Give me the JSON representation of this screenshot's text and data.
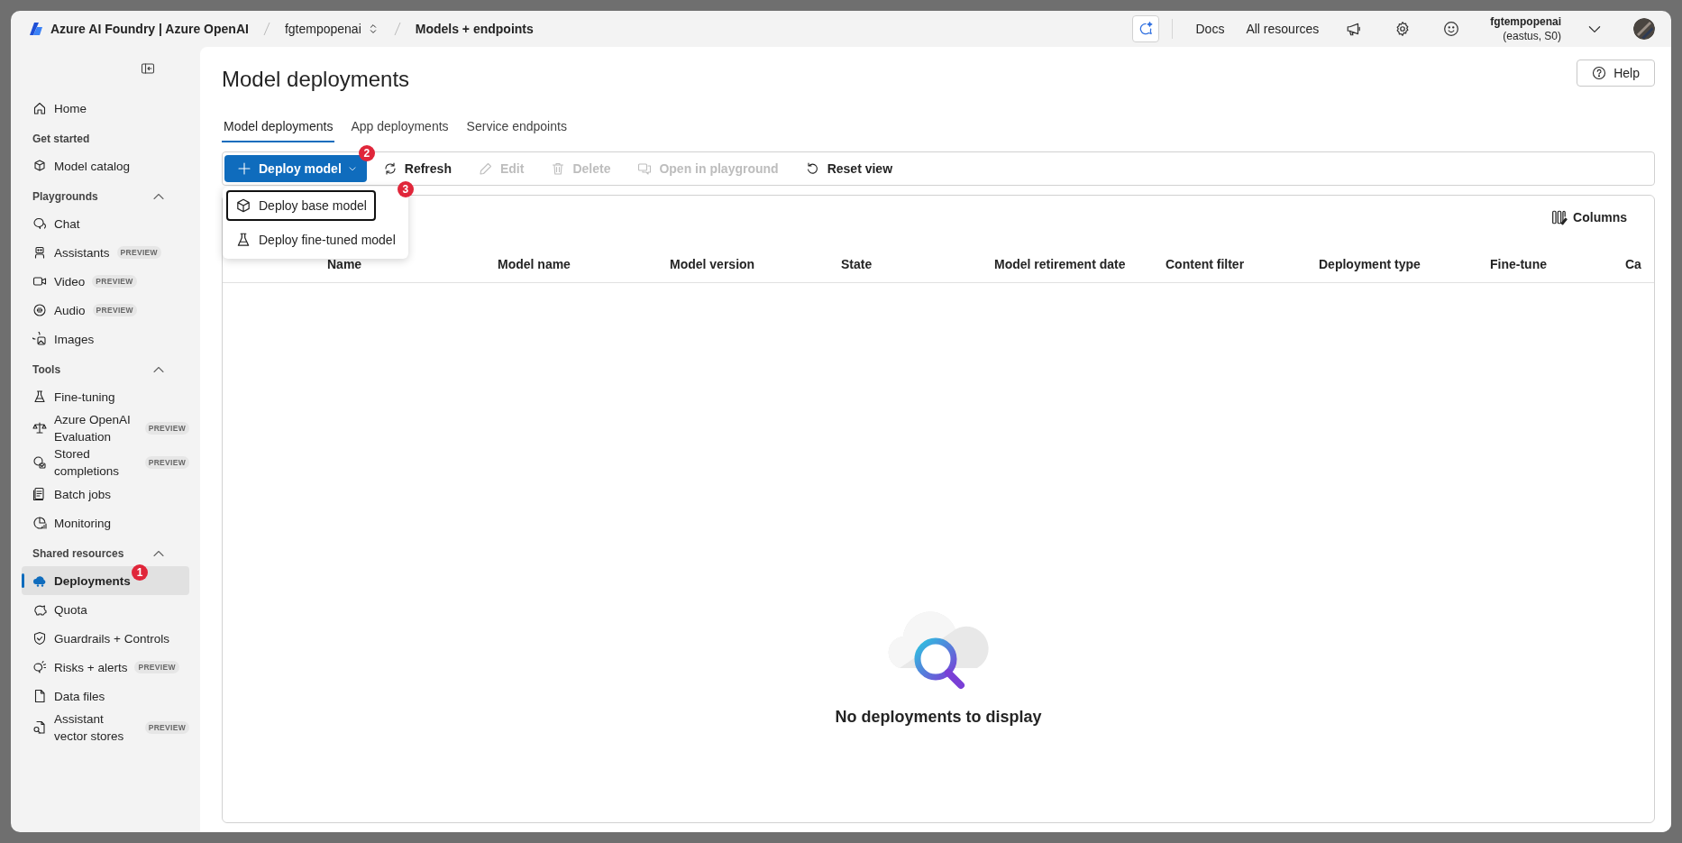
{
  "window": {
    "title": "Azure AI Foundry | Azure OpenAI"
  },
  "breadcrumb": [
    {
      "label": "fgtempopenai",
      "kind": "switcher"
    },
    {
      "label": "Models + endpoints",
      "kind": "current"
    }
  ],
  "top_links": [
    "Docs",
    "All resources"
  ],
  "account": {
    "name": "fgtempopenai",
    "detail": "(eastus, S0)"
  },
  "sidebar": {
    "items": [
      {
        "kind": "link",
        "label": "Home",
        "selected": false
      },
      {
        "kind": "heading",
        "label": "Get started"
      },
      {
        "kind": "link",
        "label": "Model catalog",
        "selected": false
      },
      {
        "kind": "heading",
        "label": "Playgrounds",
        "expanded": true
      },
      {
        "kind": "link",
        "label": "Chat",
        "selected": false
      },
      {
        "kind": "link",
        "label": "Assistants",
        "badge": "PREVIEW",
        "selected": false
      },
      {
        "kind": "link",
        "label": "Video",
        "badge": "PREVIEW",
        "selected": false
      },
      {
        "kind": "link",
        "label": "Audio",
        "badge": "PREVIEW",
        "selected": false
      },
      {
        "kind": "link",
        "label": "Images",
        "selected": false
      },
      {
        "kind": "heading",
        "label": "Tools",
        "expanded": true
      },
      {
        "kind": "link",
        "label": "Fine-tuning",
        "selected": false
      },
      {
        "kind": "link",
        "label": "Azure OpenAI Evaluation",
        "badge": "PREVIEW",
        "selected": false
      },
      {
        "kind": "link",
        "label": "Stored completions",
        "badge": "PREVIEW",
        "selected": false
      },
      {
        "kind": "link",
        "label": "Batch jobs",
        "selected": false
      },
      {
        "kind": "link",
        "label": "Monitoring",
        "selected": false
      },
      {
        "kind": "heading",
        "label": "Shared resources",
        "expanded": true
      },
      {
        "kind": "link",
        "label": "Deployments",
        "selected": true,
        "step": "1"
      },
      {
        "kind": "link",
        "label": "Quota",
        "selected": false
      },
      {
        "kind": "link",
        "label": "Guardrails + Controls",
        "selected": false
      },
      {
        "kind": "link",
        "label": "Risks + alerts",
        "badge": "PREVIEW",
        "selected": false
      },
      {
        "kind": "link",
        "label": "Data files",
        "selected": false
      },
      {
        "kind": "link",
        "label": "Assistant vector stores",
        "badge": "PREVIEW",
        "selected": false
      }
    ]
  },
  "page": {
    "title": "Model deployments",
    "help": "Help"
  },
  "tabs": [
    {
      "label": "Model deployments",
      "selected": true
    },
    {
      "label": "App deployments",
      "selected": false
    },
    {
      "label": "Service endpoints",
      "selected": false
    }
  ],
  "toolbar": [
    {
      "label": "Deploy model",
      "kind": "primary",
      "disabled": false,
      "step": "2"
    },
    {
      "label": "Refresh",
      "kind": "action",
      "disabled": false
    },
    {
      "label": "Edit",
      "kind": "action",
      "disabled": true
    },
    {
      "label": "Delete",
      "kind": "action",
      "disabled": true
    },
    {
      "label": "Open in playground",
      "kind": "action",
      "disabled": true
    },
    {
      "label": "Reset view",
      "kind": "action",
      "disabled": false
    }
  ],
  "menu": [
    {
      "label": "Deploy base model",
      "focused": true,
      "step": "3"
    },
    {
      "label": "Deploy fine-tuned model",
      "focused": false
    }
  ],
  "table": {
    "columns_button": "Columns",
    "columns": [
      "Name",
      "Model name",
      "Model version",
      "State",
      "Model retirement date",
      "Content filter",
      "Deployment type",
      "Fine-tune",
      "Ca"
    ],
    "empty_message": "No deployments to display"
  }
}
